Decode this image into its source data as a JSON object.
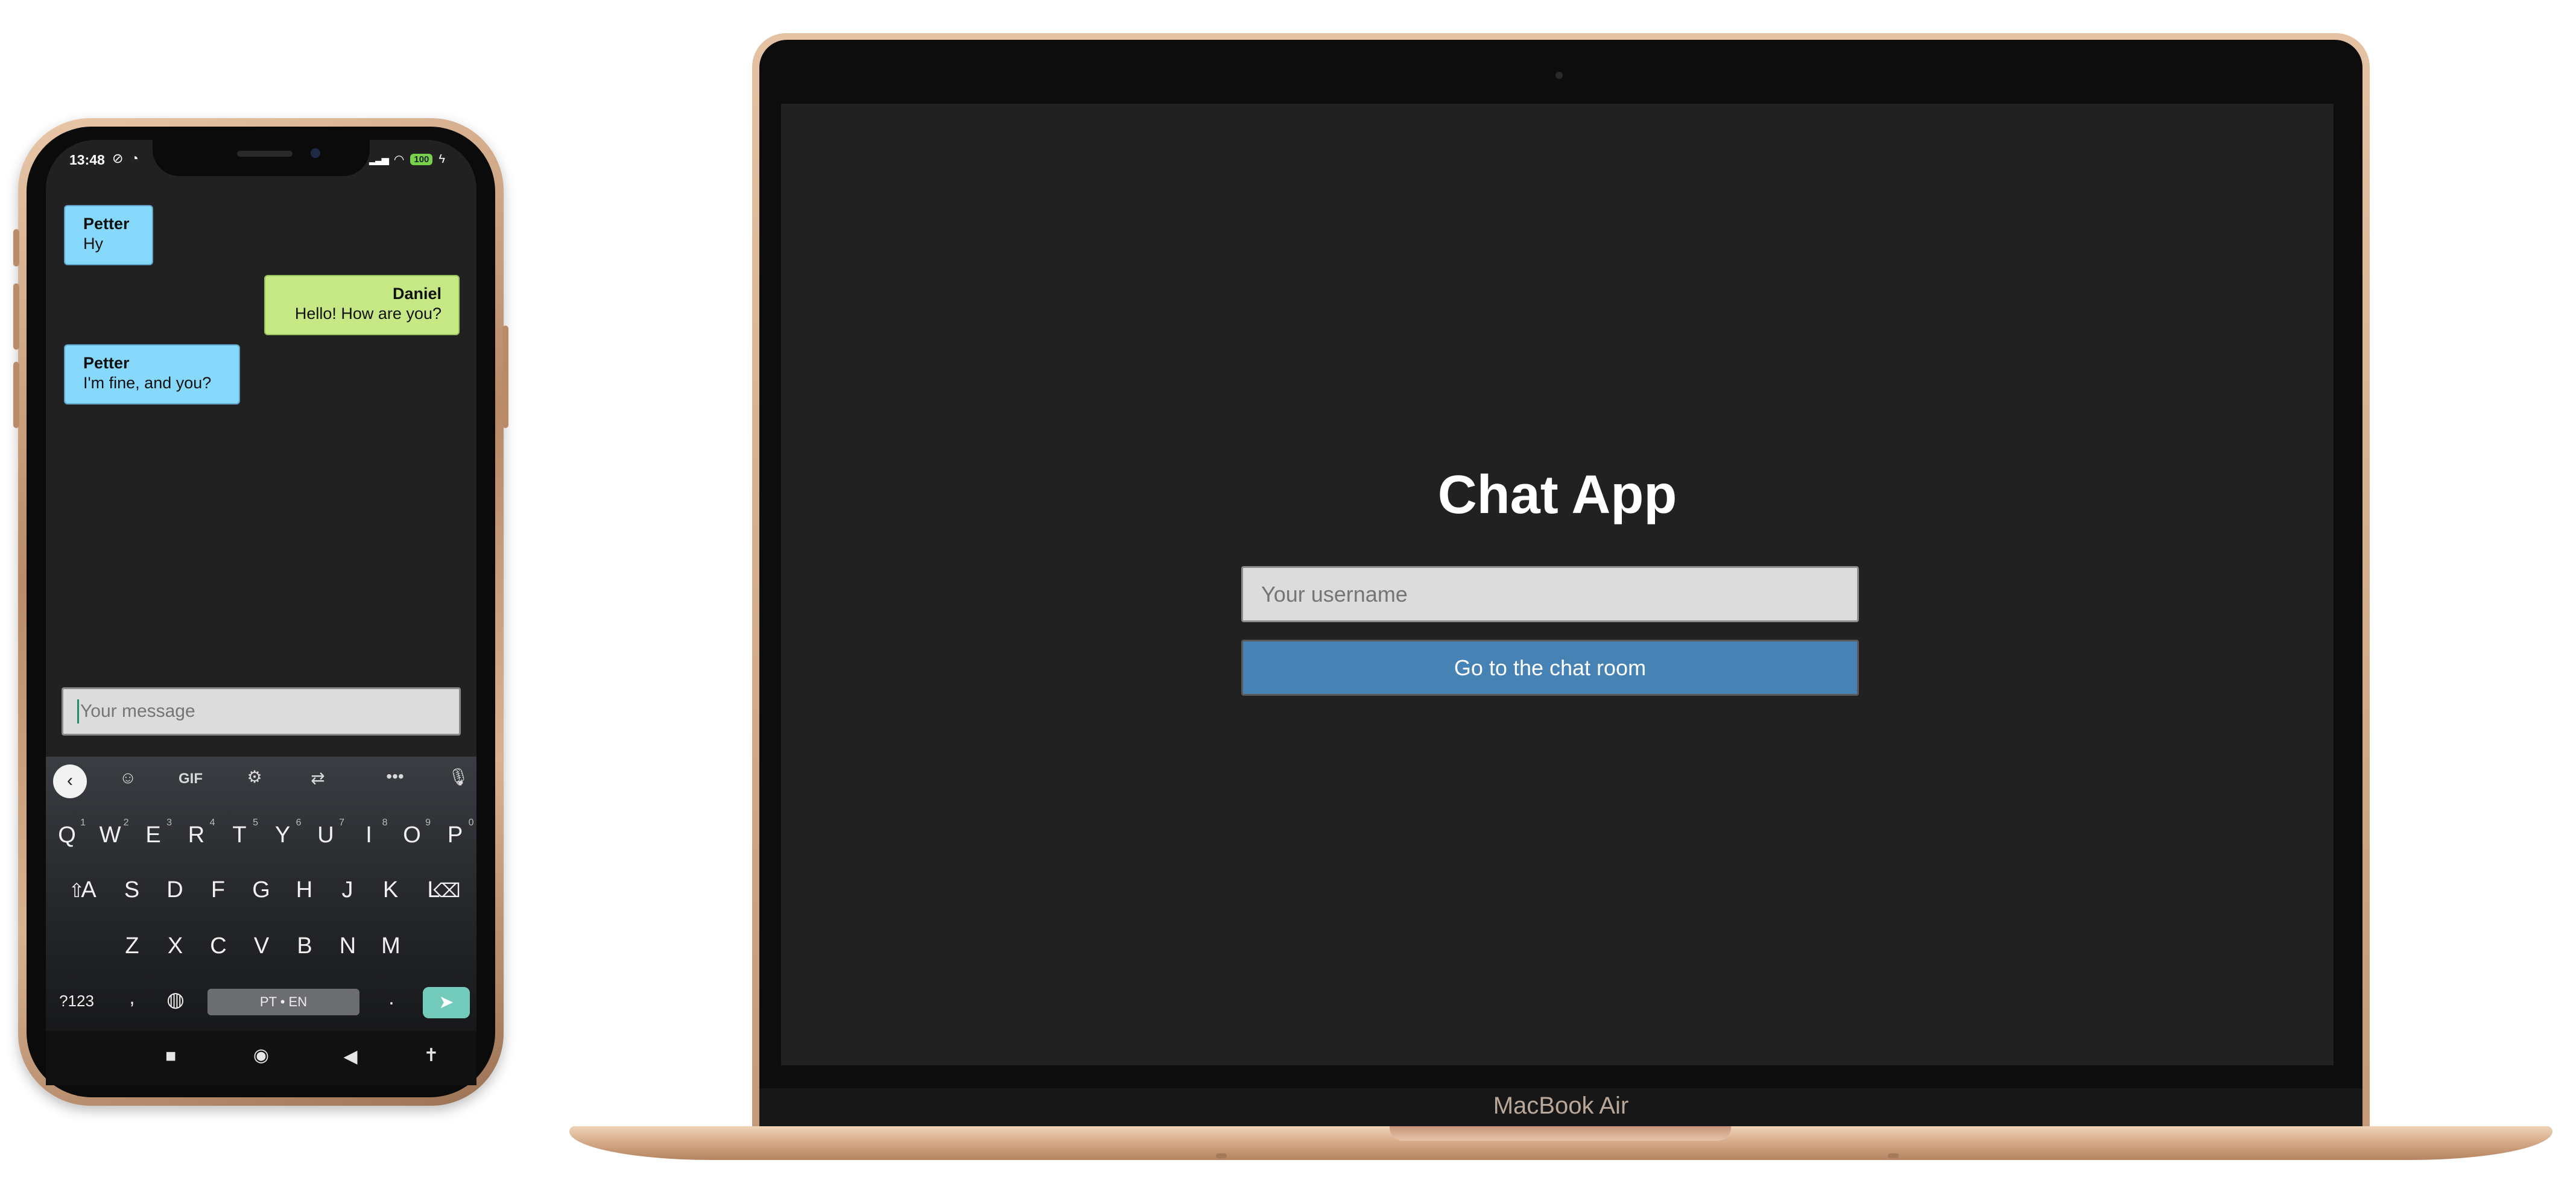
{
  "phone": {
    "status": {
      "time": "13:48",
      "battery": "100"
    },
    "messages": [
      {
        "author": "Petter",
        "text": "Hy",
        "side": "left",
        "color": "#87d9fb"
      },
      {
        "author": "Daniel",
        "text": "Hello! How are you?",
        "side": "right",
        "color": "#c6e985"
      },
      {
        "author": "Petter",
        "text": "I'm fine, and you?",
        "side": "left",
        "color": "#87d9fb"
      }
    ],
    "message_input": {
      "placeholder": "Your message"
    },
    "keyboard": {
      "toolbar": {
        "gif": "GIF",
        "more": "•••"
      },
      "row1": [
        "Q",
        "W",
        "E",
        "R",
        "T",
        "Y",
        "U",
        "I",
        "O",
        "P"
      ],
      "row1_hints": [
        "1",
        "2",
        "3",
        "4",
        "5",
        "6",
        "7",
        "8",
        "9",
        "0"
      ],
      "row2": [
        "A",
        "S",
        "D",
        "F",
        "G",
        "H",
        "J",
        "K",
        "L"
      ],
      "row3": [
        "Z",
        "X",
        "C",
        "V",
        "B",
        "N",
        "M"
      ],
      "symbols_key": "?123",
      "comma_key": ",",
      "space_label": "PT • EN",
      "period_key": "."
    }
  },
  "laptop": {
    "model_label": "MacBook Air",
    "app": {
      "title": "Chat App",
      "username_placeholder": "Your username",
      "submit_label": "Go to the chat room",
      "accent_color": "#4682b4"
    }
  }
}
